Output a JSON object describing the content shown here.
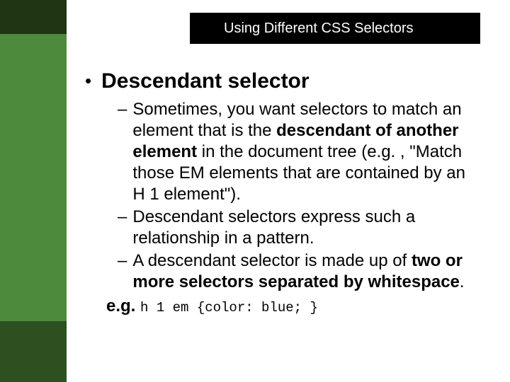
{
  "header": {
    "title": "Using Different CSS Selectors"
  },
  "main": {
    "bullet_marker": "•",
    "heading": "Descendant selector",
    "items": [
      {
        "dash": "–",
        "pre": "Sometimes, you want selectors to match an element that is the ",
        "bold": "descendant of another element",
        "post": " in the document tree (e.g. , \"Match those EM elements that are contained by an H 1 element\")."
      },
      {
        "dash": "–",
        "text": "Descendant selectors express such a relationship in a pattern."
      },
      {
        "dash": "–",
        "pre": "A descendant selector is made up of ",
        "bold": "two or more selectors separated by whitespace",
        "post": "."
      }
    ],
    "example": {
      "label": "e.g.",
      "code": "h 1 em {color: blue; }"
    }
  }
}
